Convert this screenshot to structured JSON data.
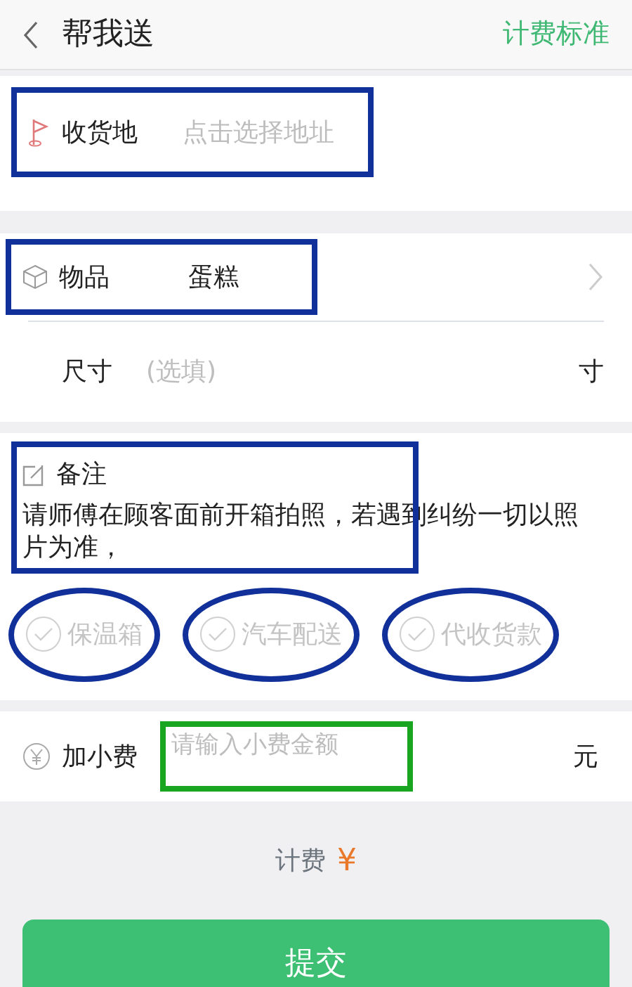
{
  "header": {
    "title": "帮我送",
    "action": "计费标准"
  },
  "address": {
    "label": "收货地",
    "placeholder": "点击选择地址",
    "annotated": true
  },
  "item": {
    "label": "物品",
    "value": "蛋糕",
    "annotated": true
  },
  "size": {
    "label": "尺寸",
    "placeholder": "(选填)",
    "unit": "寸"
  },
  "note": {
    "label": "备注",
    "text": "请师傅在顾客面前开箱拍照，若遇到纠纷一切以照片为准，",
    "annotated": true
  },
  "options": [
    {
      "label": "保温箱",
      "checked": false,
      "annotated": true
    },
    {
      "label": "汽车配送",
      "checked": false,
      "annotated": true
    },
    {
      "label": "代收货款",
      "checked": false,
      "annotated": true
    }
  ],
  "tip": {
    "label": "加小费",
    "placeholder": "请输入小费金额",
    "unit": "元",
    "annotated": true
  },
  "fee": {
    "label": "计费",
    "currency": "¥"
  },
  "submit": {
    "label": "提交"
  }
}
